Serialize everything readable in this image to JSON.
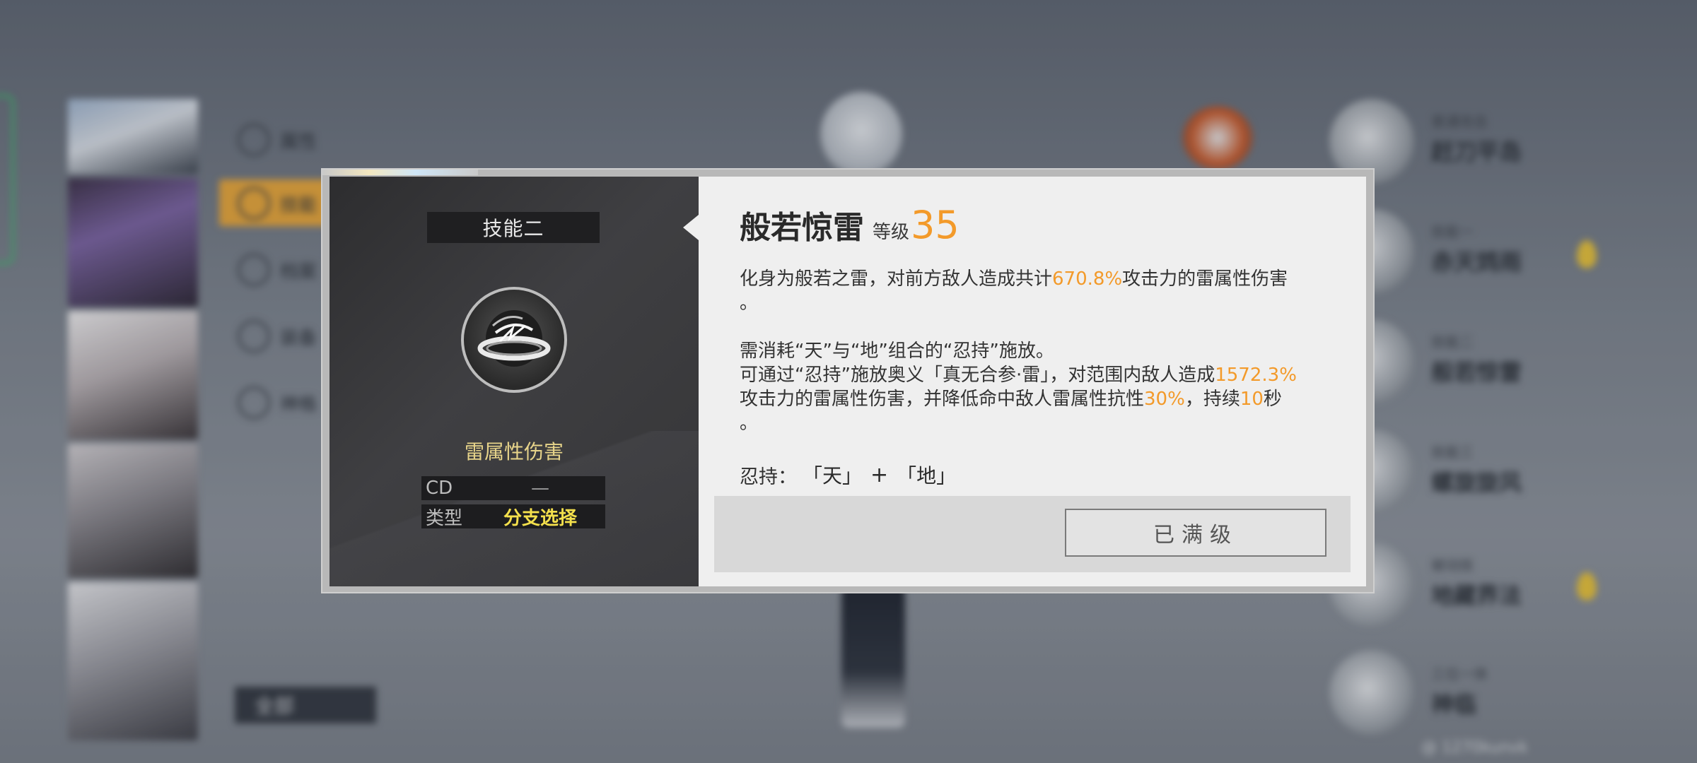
{
  "background": {
    "side_menu": [
      "属性",
      "技能",
      "档案",
      "装备",
      "神格"
    ],
    "all_button": "全部",
    "skill_nodes": [
      {
        "sub": "普通攻击",
        "name": "赶刀平岛"
      },
      {
        "sub": "技能一",
        "name": "赤天鸩雨"
      },
      {
        "sub": "技能二",
        "name": "般若惊雷"
      },
      {
        "sub": "技能三",
        "name": "螺旋旋风"
      },
      {
        "sub": "被动技",
        "name": "地藏界法"
      },
      {
        "sub": "三位一体",
        "name": "神临"
      }
    ],
    "footer_id": "@ 1270kunvk"
  },
  "modal": {
    "tab_label": "技能二",
    "element": "雷属性伤害",
    "stats": [
      {
        "key": "CD",
        "value": "—",
        "highlight": false
      },
      {
        "key": "类型",
        "value": "分支选择",
        "highlight": true
      }
    ],
    "title": "般若惊雷",
    "level_label": "等级",
    "level_value": "35",
    "desc": {
      "p1_a": "化身为般若之雷，对前方敌人造成共计",
      "p1_hl": "670.8%",
      "p1_b": "攻击力的雷属性伤害",
      "p1_c": "。",
      "p2_line1": "需消耗“天”与“地”组合的“忍持”施放。",
      "p2_a": "可通过“忍持”施放奥义「真无合参·雷」，对范围内敌人造成",
      "p2_hl1": "1572.3%",
      "p2_b": "攻击力的雷属性伤害，并降低命中敌人雷属性抗性",
      "p2_hl2": "30%",
      "p2_c": "，持续",
      "p2_hl3": "10",
      "p2_d": "秒",
      "p2_e": "。"
    },
    "combo_label": "忍持：",
    "combo_glyph1": "「天」",
    "combo_plus": "+",
    "combo_glyph2": "「地」",
    "button_label": "已满级"
  },
  "colors": {
    "accent_orange": "#f39a2a",
    "element_yellow": "#e7d48a",
    "type_yellow": "#f4e04c",
    "menu_active": "#e8a63a"
  }
}
